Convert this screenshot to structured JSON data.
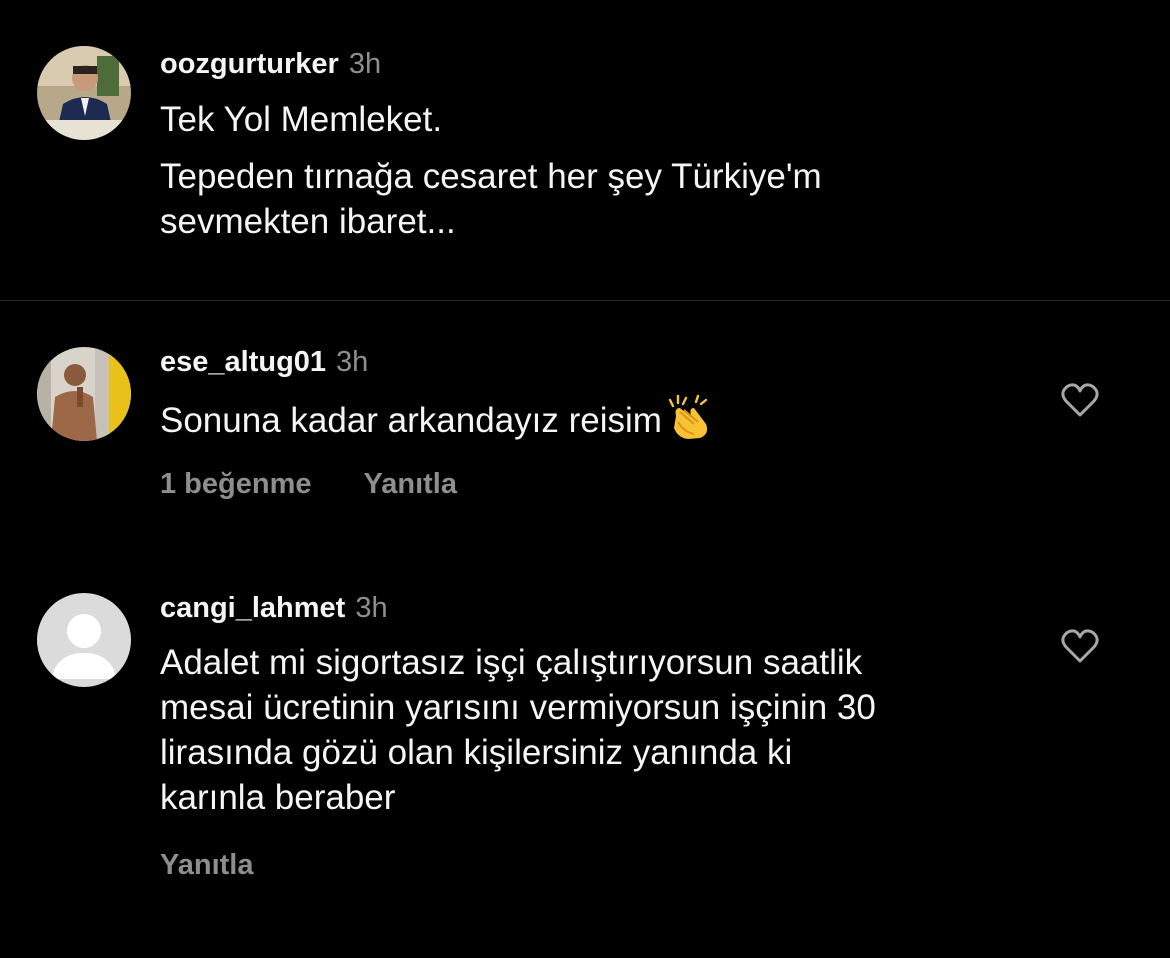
{
  "caption": {
    "username": "oozgurturker",
    "time": "3h",
    "lines": [
      "Tek Yol Memleket.",
      "Tepeden tırnağa cesaret her şey Türkiye'm",
      "sevmekten ibaret..."
    ]
  },
  "comments": [
    {
      "username": "ese_altug01",
      "time": "3h",
      "text": "Sonuna kadar arkandayız reisim",
      "emoji": "clapping-hands",
      "likes_label": "1 beğenme",
      "reply_label": "Yanıtla"
    },
    {
      "username": "cangi_lahmet",
      "time": "3h",
      "lines": [
        "Adalet mi sigortasız işçi çalıştırıyorsun saatlik",
        "mesai ücretinin yarısını vermiyorsun işçinin 30",
        "lirasında gözü olan kişilersiniz yanında ki",
        "karınla beraber"
      ],
      "reply_label": "Yanıtla"
    }
  ],
  "icons": {
    "like": "heart-outline-icon"
  },
  "colors": {
    "background": "#000000",
    "primary_text": "#f5f5f5",
    "secondary_text": "#8e8e8e",
    "divider": "#262626"
  }
}
